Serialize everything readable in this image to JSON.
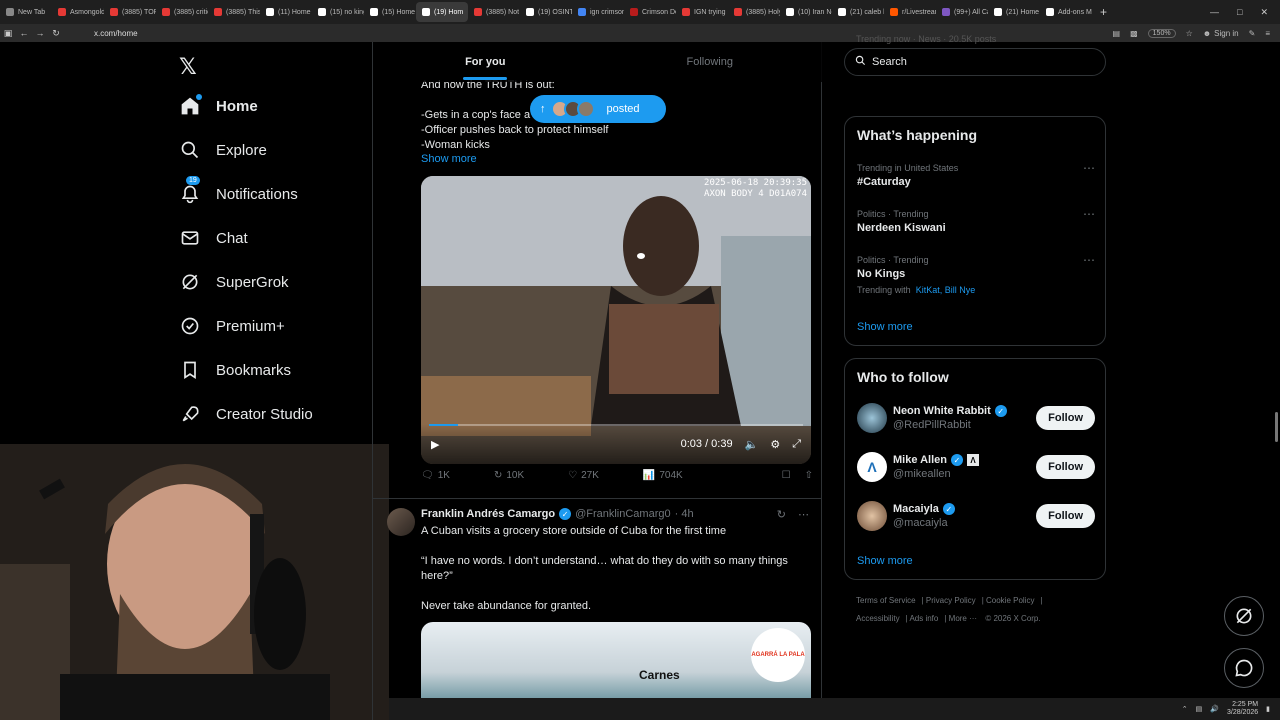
{
  "browser": {
    "tabs": [
      {
        "label": "New Tab",
        "color": "#888888"
      },
      {
        "label": "Asmongold",
        "color": "#e53935"
      },
      {
        "label": "(3885) TOP",
        "color": "#e53935"
      },
      {
        "label": "(3885) critic",
        "color": "#e53935"
      },
      {
        "label": "(3885) This",
        "color": "#e53935"
      },
      {
        "label": "(11) Home /",
        "color": "#ffffff"
      },
      {
        "label": "(15) no king",
        "color": "#ffffff"
      },
      {
        "label": "(15) Home /",
        "color": "#ffffff"
      },
      {
        "label": "(19) Hom",
        "color": "#ffffff",
        "active": true
      },
      {
        "label": "(3885) Not",
        "color": "#e53935"
      },
      {
        "label": "(19) OSINT",
        "color": "#ffffff"
      },
      {
        "label": "ign crimson",
        "color": "#4285f4"
      },
      {
        "label": "Crimson De",
        "color": "#b71c1c"
      },
      {
        "label": "IGN trying",
        "color": "#e53935"
      },
      {
        "label": "(3885) Holy",
        "color": "#e53935"
      },
      {
        "label": "(10) Iran Ne",
        "color": "#ffffff"
      },
      {
        "label": "(21) caleb h",
        "color": "#ffffff"
      },
      {
        "label": "r/Livestream",
        "color": "#ff5700"
      },
      {
        "label": "(99+) All Ca",
        "color": "#7e57c2"
      },
      {
        "label": "(21) Home",
        "color": "#ffffff"
      },
      {
        "label": "Add-ons M",
        "color": "#ffffff"
      }
    ],
    "url": "x.com/home",
    "zoom": "150%",
    "signin": "Sign in"
  },
  "nav": {
    "home": "Home",
    "explore": "Explore",
    "notifications": "Notifications",
    "notifications_badge": "19",
    "chat": "Chat",
    "supergrok": "SuperGrok",
    "premium": "Premium+",
    "bookmarks": "Bookmarks",
    "creator_studio": "Creator Studio"
  },
  "feed": {
    "tab_for_you": "For you",
    "tab_following": "Following",
    "posted_label": "posted",
    "post1": {
      "line1": "And now the TRUTH is out:",
      "line2": "-Gets in a cop's face a",
      "line3": "-Officer pushes back to protect himself",
      "line4": "-Woman kicks",
      "show_more": "Show more",
      "video_stamp1": "2025-06-18 20:39:35",
      "video_stamp2": "AXON BODY 4 D01A074",
      "video_time": "0:03 / 0:39",
      "video_progress": 0.077,
      "replies": "1K",
      "reposts": "10K",
      "likes": "27K",
      "views": "704K"
    },
    "post2": {
      "name": "Franklin Andrés Camargo",
      "handle": "@FranklinCamarg0",
      "time": "· 4h",
      "line1": "A Cuban visits a grocery store outside of Cuba for the first time",
      "line2": "“I have no words. I don’t understand… what do they do with so many things",
      "line3": "here?”",
      "line4": "Never take abundance for granted.",
      "media_sign": "Carnes",
      "media_logo": "AGARRÁ LA PALA"
    }
  },
  "sidebar": {
    "search_placeholder": "Search",
    "top_stub": "Trending now · News · 20.5K posts",
    "whats_happening": "What’s happening",
    "trends": [
      {
        "meta": "Trending in United States",
        "name": "#Caturday"
      },
      {
        "meta": "Politics · Trending",
        "name": "Nerdeen Kiswani"
      },
      {
        "meta": "Politics · Trending",
        "name": "No Kings",
        "with_label": "Trending with",
        "with_links": "KitKat, Bill Nye"
      }
    ],
    "show_more": "Show more",
    "who_to_follow": "Who to follow",
    "follow_suggestions": [
      {
        "name": "Neon White Rabbit",
        "handle": "@RedPillRabbit",
        "button": "Follow"
      },
      {
        "name": "Mike Allen",
        "handle": "@mikeallen",
        "button": "Follow"
      },
      {
        "name": "Macaiyla",
        "handle": "@macaiyla",
        "button": "Follow"
      }
    ],
    "show_more_2": "Show more",
    "footer": {
      "terms": "Terms of Service",
      "privacy": "Privacy Policy",
      "cookie": "Cookie Policy",
      "accessibility": "Accessibility",
      "ads": "Ads info",
      "more": "More ···",
      "copyright": "© 2026 X Corp."
    }
  },
  "taskbar": {
    "time": "2:25 PM",
    "date": "3/28/2026"
  }
}
